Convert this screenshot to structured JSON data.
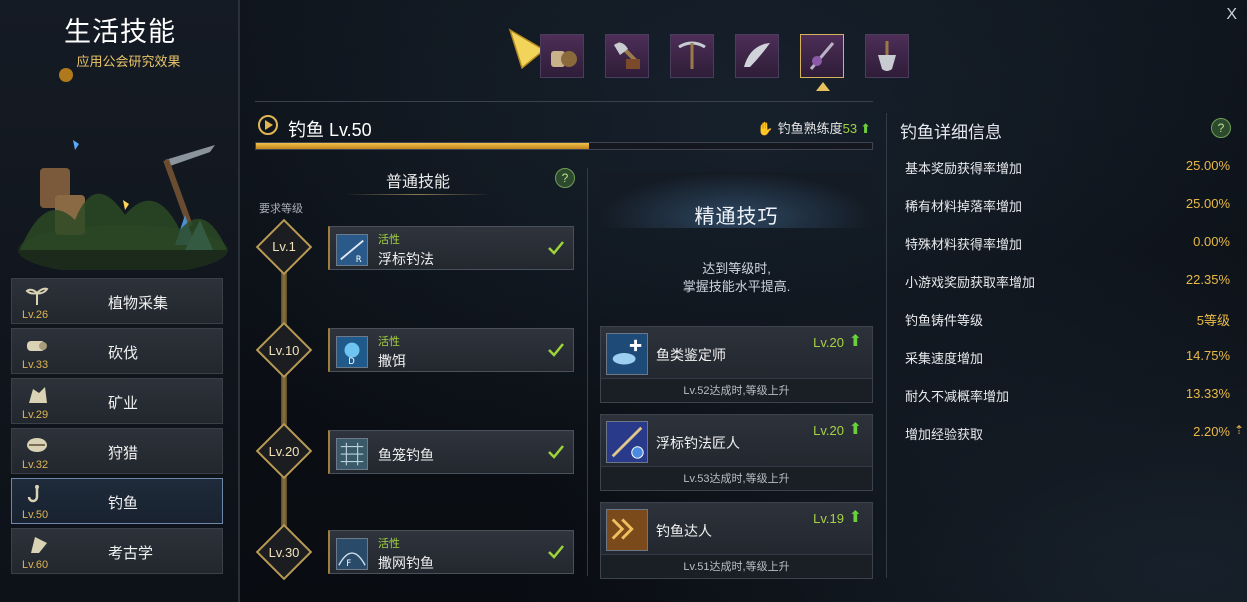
{
  "title": "生活技能",
  "subtitle": "应用公会研究效果",
  "close": "X",
  "categories": [
    {
      "name": "植物采集",
      "level": "Lv.26",
      "icon": "sprout-icon"
    },
    {
      "name": "砍伐",
      "level": "Lv.33",
      "icon": "log-icon"
    },
    {
      "name": "矿业",
      "level": "Lv.29",
      "icon": "ore-icon"
    },
    {
      "name": "狩猎",
      "level": "Lv.32",
      "icon": "hunting-icon"
    },
    {
      "name": "钓鱼",
      "level": "Lv.50",
      "icon": "fishhook-icon",
      "active": true
    },
    {
      "name": "考古学",
      "level": "Lv.60",
      "icon": "archaeology-icon"
    }
  ],
  "top_tabs": [
    "gathering-gloves-icon",
    "axe-icon",
    "pickaxe-icon",
    "hunting-knife-icon",
    "fishing-rod-icon",
    "shovel-icon"
  ],
  "skill": {
    "name": "钓鱼 Lv.50",
    "proficiency_label": "钓鱼熟练度",
    "proficiency_value": "53",
    "progress": 0.54
  },
  "normal_skills": {
    "title": "普通技能",
    "help": "?",
    "required_level_label": "要求等级",
    "items": [
      {
        "level": "Lv.1",
        "tag": "活性",
        "name": "浮标钓法",
        "key": "R"
      },
      {
        "level": "Lv.10",
        "tag": "活性",
        "name": "撒饵",
        "key": "D"
      },
      {
        "level": "Lv.20",
        "tag": "",
        "name": "鱼笼钓鱼",
        "key": ""
      },
      {
        "level": "Lv.30",
        "tag": "活性",
        "name": "撒网钓鱼",
        "key": "F"
      }
    ]
  },
  "mastery": {
    "title": "精通技巧",
    "desc1": "达到等级时,",
    "desc2": "掌握技能水平提高.",
    "items": [
      {
        "name": "鱼类鉴定师",
        "level": "Lv.20",
        "footer": "Lv.52达成时,等级上升"
      },
      {
        "name": "浮标钓法匠人",
        "level": "Lv.20",
        "footer": "Lv.53达成时,等级上升"
      },
      {
        "name": "钓鱼达人",
        "level": "Lv.19",
        "footer": "Lv.51达成时,等级上升"
      }
    ]
  },
  "details": {
    "title": "钓鱼详细信息",
    "help": "?",
    "rows": [
      {
        "label": "基本奖励获得率增加",
        "value": "25.00%"
      },
      {
        "label": "稀有材料掉落率增加",
        "value": "25.00%"
      },
      {
        "label": "特殊材料获得率增加",
        "value": "0.00%"
      },
      {
        "label": "小游戏奖励获取率增加",
        "value": "22.35%"
      },
      {
        "label": "钓鱼铸件等级",
        "value": "5等级"
      },
      {
        "label": "采集速度增加",
        "value": "14.75%"
      },
      {
        "label": "耐久不减概率增加",
        "value": "13.33%"
      },
      {
        "label": "增加经验获取",
        "value": "2.20%",
        "up": "⇡"
      }
    ]
  },
  "colors": {
    "accent": "#e0b552",
    "green": "#a6d344"
  }
}
